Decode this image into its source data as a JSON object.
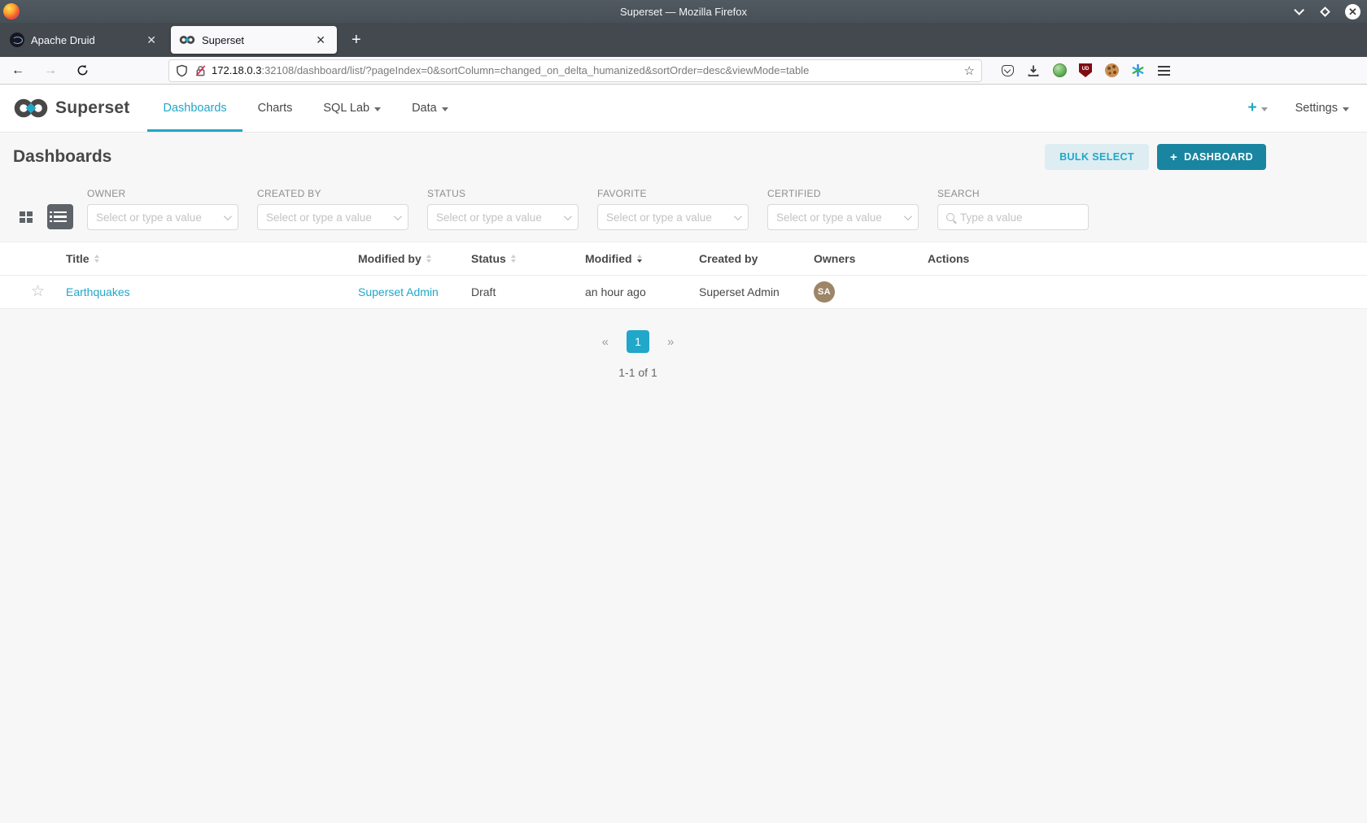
{
  "titlebar": {
    "title": "Superset — Mozilla Firefox"
  },
  "tabs": {
    "tab1_label": "Apache Druid",
    "tab2_label": "Superset",
    "close_glyph": "✕",
    "new_tab_glyph": "+"
  },
  "urlbar": {
    "host": "172.18.0.3",
    "rest": ":32108/dashboard/list/?pageIndex=0&sortColumn=changed_on_delta_humanized&sortOrder=desc&viewMode=table",
    "star_glyph": "☆"
  },
  "chrome": {
    "back_glyph": "←",
    "forward_glyph": "→",
    "ublock_label": "UD",
    "close_btn_glyph": "✕"
  },
  "navbar": {
    "brand": "Superset",
    "item_dashboards": "Dashboards",
    "item_charts": "Charts",
    "item_sql_lab": "SQL Lab",
    "item_data": "Data",
    "plus": "+",
    "settings": "Settings"
  },
  "page": {
    "title": "Dashboards",
    "bulk_select": "BULK SELECT",
    "new_dashboard_plus": "+",
    "new_dashboard": "DASHBOARD"
  },
  "filters": {
    "owner": {
      "label": "OWNER",
      "placeholder": "Select or type a value"
    },
    "created_by": {
      "label": "CREATED BY",
      "placeholder": "Select or type a value"
    },
    "status": {
      "label": "STATUS",
      "placeholder": "Select or type a value"
    },
    "favorite": {
      "label": "FAVORITE",
      "placeholder": "Select or type a value"
    },
    "certified": {
      "label": "CERTIFIED",
      "placeholder": "Select or type a value"
    },
    "search": {
      "label": "SEARCH",
      "placeholder": "Type a value"
    }
  },
  "table": {
    "headers": {
      "title": "Title",
      "modified_by": "Modified by",
      "status": "Status",
      "modified": "Modified",
      "created_by": "Created by",
      "owners": "Owners",
      "actions": "Actions"
    },
    "row": {
      "favorite_glyph": "☆",
      "title": "Earthquakes",
      "modified_by": "Superset Admin",
      "status": "Draft",
      "modified": "an hour ago",
      "created_by": "Superset Admin",
      "owner_initials": "SA"
    },
    "sort_state": "Modified sorted descending"
  },
  "pagination": {
    "prev_glyph": "«",
    "page": "1",
    "next_glyph": "»",
    "summary": "1-1 of 1"
  },
  "colors": {
    "accent": "#20a7c9",
    "primary_button": "#1985a0",
    "bulk_select_bg": "#e4f4f8",
    "avatar_bg": "#9d8568",
    "titlebar_bg": "#475056",
    "tabstrip_bg": "#43494e",
    "content_bg": "#f7f7f7"
  }
}
